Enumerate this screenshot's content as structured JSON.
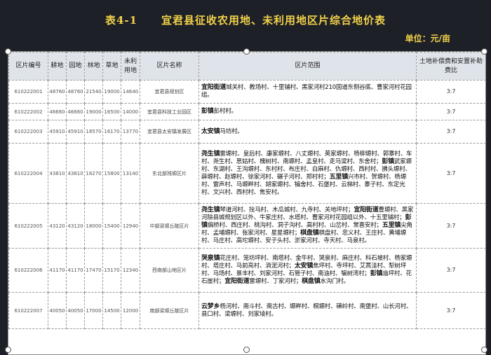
{
  "title": {
    "number": "表4-1",
    "text": "宜君县征收农用地、未利用地区片综合地价表"
  },
  "unit_label": "单位：元/亩",
  "table": {
    "headers": [
      "区片编号",
      "耕地",
      "园地",
      "林地",
      "草地",
      "未利用地",
      "区片名称",
      "区片范围",
      "土地补偿费和安置补助费比"
    ],
    "rows": [
      {
        "code": "610222001",
        "cultivated": "48760",
        "garden": "48760",
        "forest": "21540",
        "grass": "19000",
        "unused": "14640",
        "name": "宜君县规划区",
        "range": [
          {
            "t": "宜阳街道",
            "b": true
          },
          {
            "t": "城关村、教场村、十里铺村、黑家河村210国道东侧谷底、曹家河村花园组。",
            "b": false
          }
        ],
        "ratio": "3:7"
      },
      {
        "code": "610222002",
        "cultivated": "46660",
        "garden": "46660",
        "forest": "19000",
        "grass": "16500",
        "unused": "14000",
        "name": "宜君县科技工业园区",
        "range": [
          {
            "t": "彭镇",
            "b": true
          },
          {
            "t": "彭村村。",
            "b": false
          }
        ],
        "ratio": "3:7"
      },
      {
        "code": "610222003",
        "cultivated": "45910",
        "garden": "45910",
        "forest": "18570",
        "grass": "16170",
        "unused": "13770",
        "name": "宜君县太安镇发展区",
        "range": [
          {
            "t": "太安镇",
            "b": true
          },
          {
            "t": "马坊村。",
            "b": false
          }
        ],
        "ratio": "3:7"
      },
      {
        "code": "610222004",
        "cultivated": "43810",
        "garden": "43810",
        "forest": "18270",
        "grass": "15800",
        "unused": "13140",
        "name": "东北部残塬区片",
        "range": [
          {
            "t": "尧生镇",
            "b": true
          },
          {
            "t": "雷塬村、皇后村、康家塬村、八丈塬村、英家塬村、杨柳塬村、郭寨村、车村、尧生村、思姑村、槐树村、南塬村、孟皇村、走马梁村、东舍村；",
            "b": false
          },
          {
            "t": "彭镇",
            "b": true
          },
          {
            "t": "武家塬村、东湖村、王沟塬村、东村村、布庄村、白麻村、仇塬村、西村村、拂头塬村、薛塬村、赵塬村、徐家河村、碾子河村、郑村村；",
            "b": false
          },
          {
            "t": "五里镇",
            "b": true
          },
          {
            "t": "兴市村、贺塬村、杨塬村、雷声村、马塬畔村、胡家塬村、犏舍村、石堡村、云梯村、寨子村、东定光村、文兴村、西村村、焦安村。",
            "b": false
          }
        ],
        "ratio": "3:7"
      },
      {
        "code": "610222005",
        "cultivated": "43120",
        "garden": "43120",
        "forest": "18000",
        "grass": "15400",
        "unused": "12940",
        "name": "中部梁塬丘陵区片",
        "range": [
          {
            "t": "尧生镇",
            "b": true
          },
          {
            "t": "琴道河村、拴马村、木瓜城村、九寺村、关地坪村；",
            "b": false
          },
          {
            "t": "宜阳街道",
            "b": true
          },
          {
            "t": "曹塬村、黑家河除县城规划区以外、牛家庄村、水塔村、曹家河村花园组以外、十五里铺村；",
            "b": false
          },
          {
            "t": "彭镇",
            "b": true
          },
          {
            "t": "偏桥村、西庄村、桃沟村、洞子沟村、高村村、山岔村、常喜安村；",
            "b": false
          },
          {
            "t": "五里镇",
            "b": true
          },
          {
            "t": "尖角村、孟埔塬村、张家河村、星星塬村；",
            "b": false
          },
          {
            "t": "棋盘镇",
            "b": true
          },
          {
            "t": "棋盘村、忠义村、王庄村、黄埔塬村、马庄村、高坨塬村、安子头村、淤家河村、寺天村、马泉村。",
            "b": false
          }
        ],
        "ratio": "3:7"
      },
      {
        "code": "610222006",
        "cultivated": "41170",
        "garden": "41170",
        "forest": "17470",
        "grass": "15170",
        "unused": "12340",
        "name": "西南部山地区片",
        "range": [
          {
            "t": "哭泉镇",
            "b": true
          },
          {
            "t": "花庄村、笼坊坪村、南塔村、金牛村、哭泉村、麻庄村、科石坡村、杨家塬村、塔庄村、马前亮村、淌泥河村；",
            "b": false
          },
          {
            "t": "太安镇",
            "b": true
          },
          {
            "t": "焦坪村、寺坪村、艾蒿洼村、犁树坪村、马场村、景丰村、刘家河村、石管子村、南油村、犏树湾村；",
            "b": false
          },
          {
            "t": "彭镇",
            "b": true
          },
          {
            "t": "庙坪村、花石崖村；",
            "b": false
          },
          {
            "t": "宜阳街道",
            "b": true
          },
          {
            "t": "雷塬村、丁家河村；",
            "b": false
          },
          {
            "t": "棋盘镇",
            "b": true
          },
          {
            "t": "水沟门村。",
            "b": false
          }
        ],
        "ratio": "3:7"
      },
      {
        "code": "610222007",
        "cultivated": "40050",
        "garden": "40050",
        "forest": "17000",
        "grass": "14500",
        "unused": "12000",
        "name": "南部梁塬丘陵区片",
        "range": [
          {
            "t": "云梦乡",
            "b": true
          },
          {
            "t": "杨河村、南斗村、南古村、塬畔村、桐塬村、磺岭村、南堡村、山长河村、县口村、梁塬村、刘家堎村。",
            "b": false
          }
        ],
        "ratio": "3:7"
      }
    ]
  }
}
